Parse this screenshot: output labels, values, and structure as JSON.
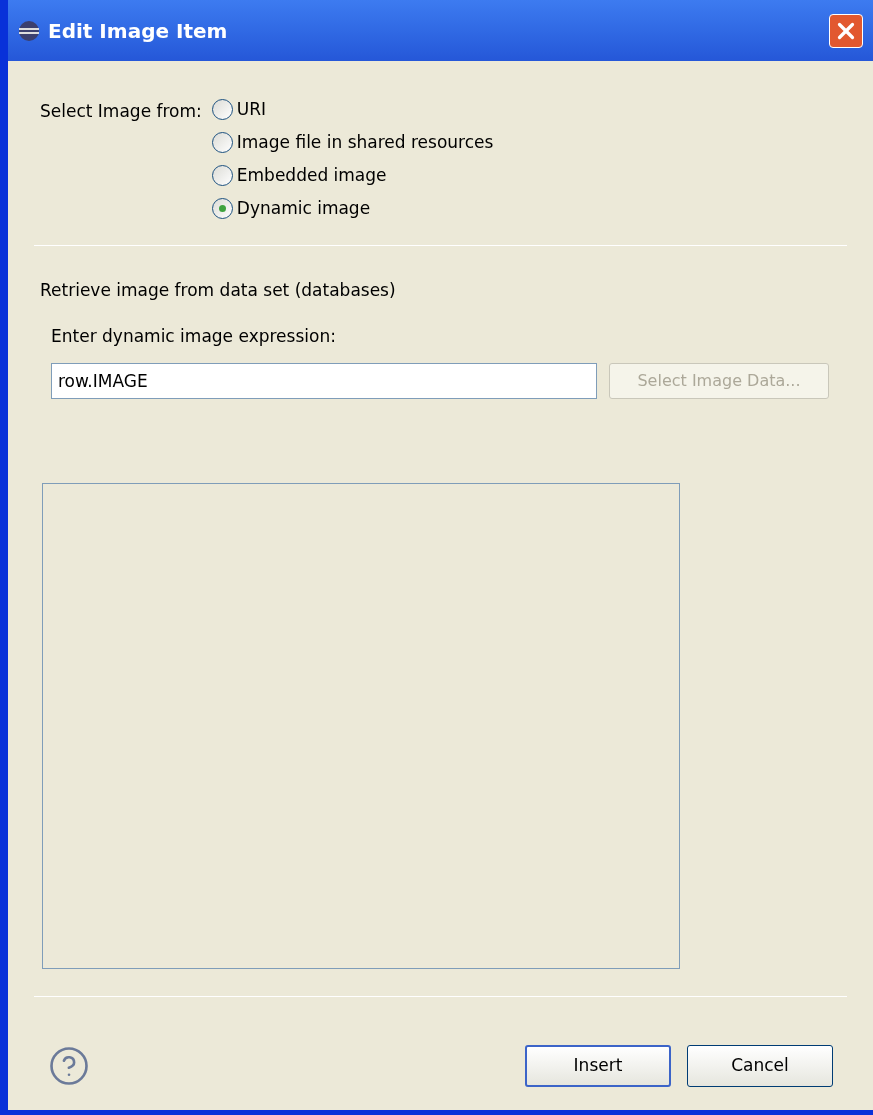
{
  "window": {
    "title": "Edit Image Item"
  },
  "source": {
    "label": "Select Image from:",
    "options": [
      {
        "label": "URI",
        "selected": false
      },
      {
        "label": "Image file in shared resources",
        "selected": false
      },
      {
        "label": "Embedded image",
        "selected": false
      },
      {
        "label": "Dynamic image",
        "selected": true
      }
    ]
  },
  "section_title": "Retrieve image from data set (databases)",
  "expression": {
    "label": "Enter dynamic image expression:",
    "value": "row.IMAGE"
  },
  "select_data_button": {
    "label": "Select Image Data...",
    "disabled": true
  },
  "buttons": [
    {
      "label": "Insert",
      "default": true
    },
    {
      "label": "Cancel",
      "default": false
    }
  ]
}
